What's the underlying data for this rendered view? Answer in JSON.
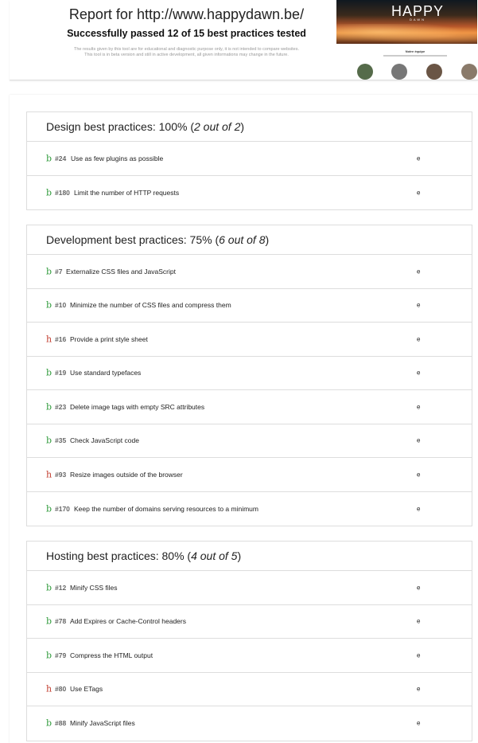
{
  "header": {
    "title": "Report for http://www.happydawn.be/",
    "subtitle": "Successfully passed 12 of 15 best practices tested",
    "disclaimer_line1": "The results given by this tool are for educational and diagnostic purpose only, it is not intended to compare websites.",
    "disclaimer_line2": "This tool is in beta version and still in active development, all given informations may change in the future.",
    "thumbnail": {
      "logo": "HAPPY",
      "logo_sub": "DAWN",
      "caption": "Notre équipe"
    }
  },
  "sections": [
    {
      "title": "Design best practices: 100% (",
      "score": "2 out of 2",
      "close": ")",
      "items": [
        {
          "icon": "b",
          "status": "pass",
          "id": "#24",
          "text": "Use as few plugins as possible",
          "expand": "e"
        },
        {
          "icon": "b",
          "status": "pass",
          "id": "#180",
          "text": "Limit the number of HTTP requests",
          "expand": "e"
        }
      ]
    },
    {
      "title": "Development best practices: 75% (",
      "score": "6 out of 8",
      "close": ")",
      "items": [
        {
          "icon": "b",
          "status": "pass",
          "id": "#7",
          "text": "Externalize CSS files and JavaScript",
          "expand": "e"
        },
        {
          "icon": "b",
          "status": "pass",
          "id": "#10",
          "text": "Minimize the number of CSS files and compress them",
          "expand": "e"
        },
        {
          "icon": "h",
          "status": "fail",
          "id": "#16",
          "text": "Provide a print style sheet",
          "expand": "e"
        },
        {
          "icon": "b",
          "status": "pass",
          "id": "#19",
          "text": "Use standard typefaces",
          "expand": "e"
        },
        {
          "icon": "b",
          "status": "pass",
          "id": "#23",
          "text": "Delete image tags with empty SRC attributes",
          "expand": "e"
        },
        {
          "icon": "b",
          "status": "pass",
          "id": "#35",
          "text": "Check JavaScript code",
          "expand": "e"
        },
        {
          "icon": "h",
          "status": "fail",
          "id": "#93",
          "text": "Resize images outside of the browser",
          "expand": "e"
        },
        {
          "icon": "b",
          "status": "pass",
          "id": "#170",
          "text": "Keep the number of domains serving resources to a minimum",
          "expand": "e"
        }
      ]
    },
    {
      "title": "Hosting best practices: 80% (",
      "score": "4 out of 5",
      "close": ")",
      "items": [
        {
          "icon": "b",
          "status": "pass",
          "id": "#12",
          "text": "Minify CSS files",
          "expand": "e"
        },
        {
          "icon": "b",
          "status": "pass",
          "id": "#78",
          "text": "Add Expires or Cache-Control headers",
          "expand": "e"
        },
        {
          "icon": "b",
          "status": "pass",
          "id": "#79",
          "text": "Compress the HTML output",
          "expand": "e"
        },
        {
          "icon": "h",
          "status": "fail",
          "id": "#80",
          "text": "Use ETags",
          "expand": "e"
        },
        {
          "icon": "b",
          "status": "pass",
          "id": "#88",
          "text": "Minify JavaScript files",
          "expand": "e"
        }
      ]
    }
  ]
}
